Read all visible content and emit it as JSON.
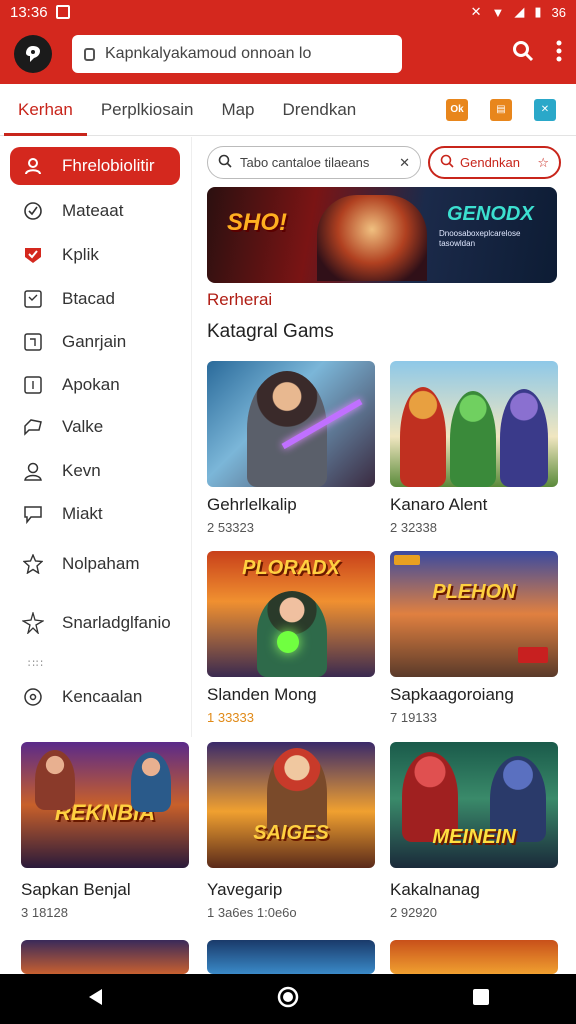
{
  "status_bar": {
    "time": "13:36",
    "battery": "36"
  },
  "app_bar": {
    "url": "Kapnkalyakamoud onnoan lo"
  },
  "tabs": [
    {
      "label": "Kerhan"
    },
    {
      "label": "Perplkiosain"
    },
    {
      "label": "Map"
    },
    {
      "label": "Drendkan"
    }
  ],
  "tab_icons": [
    {
      "icon": "ok-badge-icon",
      "text": "Ok",
      "color": "#e8861c"
    },
    {
      "icon": "card-icon",
      "color": "#e8861c"
    },
    {
      "icon": "x-app-icon",
      "color": "#2aa8c9"
    }
  ],
  "sidebar": {
    "items": [
      {
        "label": "Fhrelobiolitir",
        "icon": "user-icon"
      },
      {
        "label": "Mateaat",
        "icon": "shield-check-icon"
      },
      {
        "label": "Kplik",
        "icon": "red-check-icon"
      },
      {
        "label": "Btacad",
        "icon": "square-face-icon"
      },
      {
        "label": "Ganrjain",
        "icon": "square-bracket-icon"
      },
      {
        "label": "Apokan",
        "icon": "square-line-icon"
      },
      {
        "label": "Valke",
        "icon": "speech-bubble-icon"
      },
      {
        "label": "Kevn",
        "icon": "person-outline-icon"
      },
      {
        "label": "Miakt",
        "icon": "chat-icon"
      },
      {
        "label": "Nolpaham",
        "icon": "star-outline-icon"
      },
      {
        "label": "Snarladglfanio",
        "icon": "sparkle-icon"
      },
      {
        "label": "Kencaalan",
        "icon": "gear-circle-icon"
      }
    ],
    "dots": "∷∷"
  },
  "search": {
    "placeholder": "Tabo cantaloe tilaeans",
    "filter_label": "Gendnkan"
  },
  "banner": {
    "left_text": "SHO!",
    "title": "GENODX",
    "subtitle": "Dnoosaboxeplcarelose tasowldan"
  },
  "section": {
    "kicker": "Rerherai",
    "title": "Katagral Gams"
  },
  "cards": [
    {
      "title": "Gehrlelkalip",
      "count": "2 53323",
      "count_style": "normal",
      "art": "SWORD",
      "logo": ""
    },
    {
      "title": "Kanaro Alent",
      "count": "2 32338",
      "count_style": "normal",
      "art": "HEROES",
      "logo": ""
    },
    {
      "title": "Slanden Mong",
      "count": "1 33333",
      "count_style": "orange",
      "art": "BLASTER",
      "logo": "PLORADX"
    },
    {
      "title": "Sapkaagoroiang",
      "count": "7 19133",
      "count_style": "normal",
      "art": "CITY",
      "logo": "PLEHON"
    },
    {
      "title": "Sapkan Benjal",
      "count": "3 18128",
      "count_style": "normal",
      "art": "SQUAD",
      "logo": "REKNBIA"
    },
    {
      "title": "Yavegarip",
      "count": "1 3a6es 1:0e6o",
      "count_style": "normal",
      "art": "WARRIOR",
      "logo": "SAIGES"
    },
    {
      "title": "Kakalnanag",
      "count": "2 92920",
      "count_style": "normal",
      "art": "MECH",
      "logo": "MEINEIN"
    }
  ]
}
